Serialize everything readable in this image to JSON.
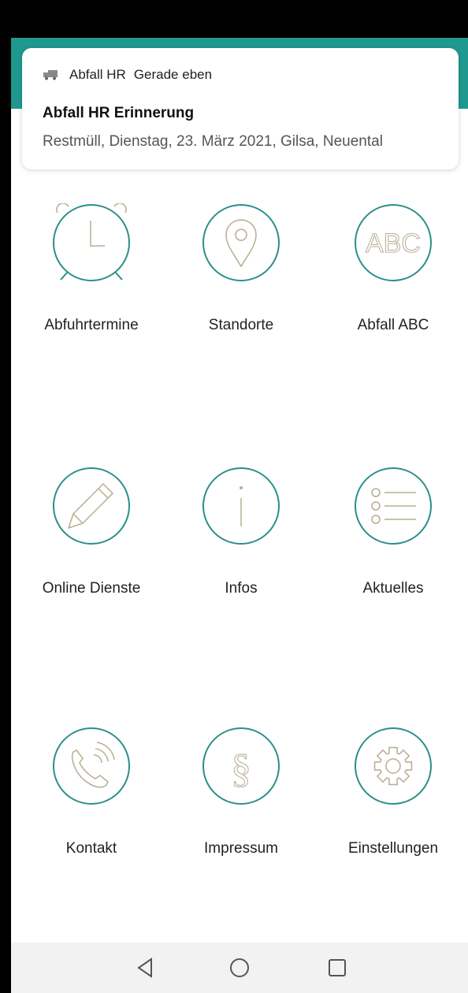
{
  "notification": {
    "app_name": "Abfall HR",
    "time": "Gerade eben",
    "title": "Abfall HR Erinnerung",
    "body": "Restmüll, Dienstag, 23. März 2021, Gilsa, Neuental",
    "icon": "truck-icon"
  },
  "menu": {
    "items": [
      {
        "label": "Abfuhrtermine",
        "icon": "alarm-clock-icon"
      },
      {
        "label": "Standorte",
        "icon": "location-pin-icon"
      },
      {
        "label": "Abfall ABC",
        "icon": "abc-icon"
      },
      {
        "label": "Online Dienste",
        "icon": "pencil-icon"
      },
      {
        "label": "Infos",
        "icon": "info-icon"
      },
      {
        "label": "Aktuelles",
        "icon": "list-icon"
      },
      {
        "label": "Kontakt",
        "icon": "phone-icon"
      },
      {
        "label": "Impressum",
        "icon": "paragraph-icon"
      },
      {
        "label": "Einstellungen",
        "icon": "gear-icon"
      }
    ],
    "abc_text": "ABC",
    "paragraph_symbol": "§"
  },
  "navigation": {
    "buttons": [
      "back-icon",
      "home-icon",
      "recents-icon"
    ]
  },
  "colors": {
    "teal": "#1f9990",
    "icon_ring": "#2a8f8a",
    "icon_line": "#b7ad92"
  }
}
